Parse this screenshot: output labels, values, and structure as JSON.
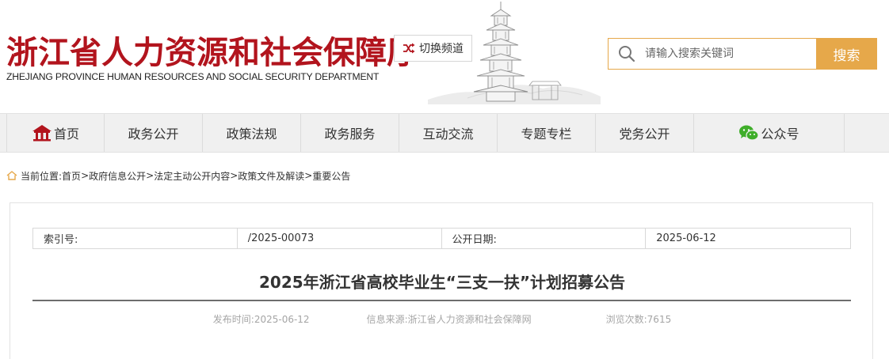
{
  "header": {
    "logo_cn": "浙江省人力资源和社会保障厅",
    "logo_en": "ZHEJIANG PROVINCE HUMAN RESOURCES AND SOCIAL SECURITY DEPARTMENT",
    "switch_label": "切换频道",
    "search": {
      "placeholder": "请输入搜索关键词",
      "button_label": "搜索"
    }
  },
  "nav": {
    "items": [
      {
        "label": "首页",
        "icon": "home-icon"
      },
      {
        "label": "政务公开"
      },
      {
        "label": "政策法规"
      },
      {
        "label": "政务服务"
      },
      {
        "label": "互动交流"
      },
      {
        "label": "专题专栏"
      },
      {
        "label": "党务公开"
      },
      {
        "label": "公众号",
        "icon": "wechat-icon"
      }
    ]
  },
  "breadcrumb": {
    "prefix": "当前位置:",
    "items": [
      "首页",
      "政府信息公开",
      "法定主动公开内容",
      "政策文件及解读",
      "重要公告"
    ],
    "separator": ">"
  },
  "meta": {
    "index_label": "索引号:",
    "index_value": "/2025-00073",
    "date_label": "公开日期:",
    "date_value": "2025-06-12"
  },
  "article": {
    "title": "2025年浙江省高校毕业生“三支一扶”计划招募公告",
    "publish_time": "发布时间:2025-06-12",
    "source": "信息来源:浙江省人力资源和社会保障网",
    "views": "浏览次数:7615"
  },
  "colors": {
    "brand_red": "#b2141d",
    "accent_orange": "#e6a84a",
    "nav_bg": "#f0f0f0"
  }
}
